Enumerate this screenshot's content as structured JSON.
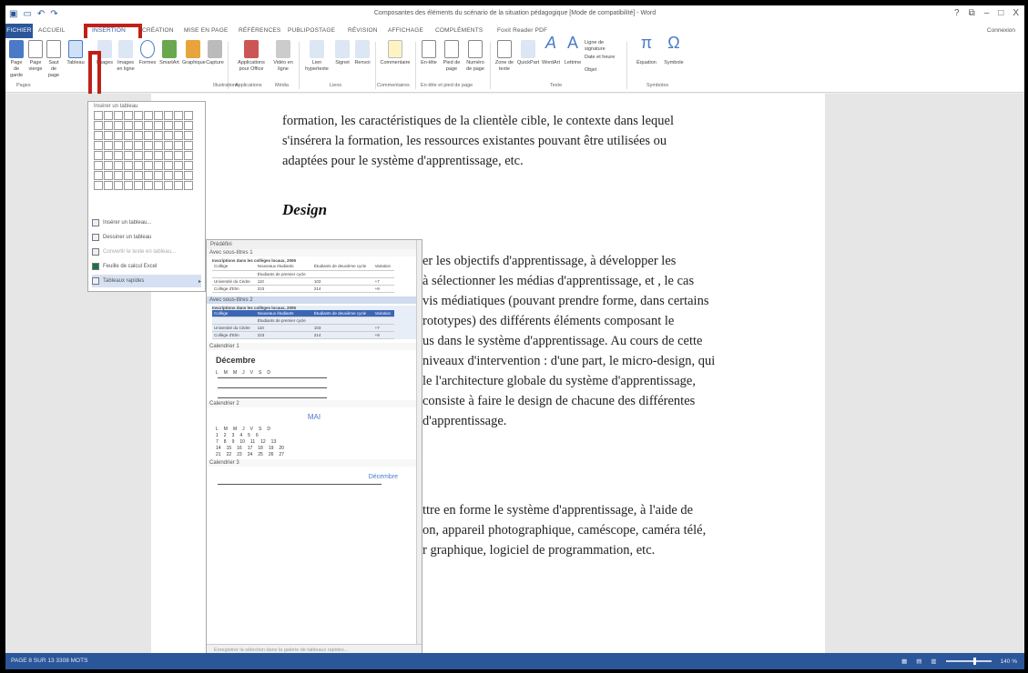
{
  "titlebar": {
    "title": "Composantes des éléments du scénario de la situation pédagogique [Mode de compatibilité] - Word",
    "help": "?",
    "win_restore": "⧉",
    "win_min": "–",
    "win_max": "□",
    "win_close": "X"
  },
  "tabs": [
    "FICHIER",
    "ACCUEIL",
    "INSERTION",
    "CRÉATION",
    "MISE EN PAGE",
    "RÉFÉRENCES",
    "PUBLIPOSTAGE",
    "RÉVISION",
    "AFFICHAGE",
    "COMPLÉMENTS",
    "Foxit Reader PDF"
  ],
  "connexion": "Connexion",
  "ribbon": {
    "buttons": [
      "Page de garde",
      "Page vierge",
      "Saut de page",
      "Tableau",
      "Images",
      "Images en ligne",
      "Formes",
      "SmartArt",
      "Graphique",
      "Capture",
      "Applications pour Office",
      "Vidéo en ligne",
      "Lien hypertexte",
      "Signet",
      "Renvoi",
      "Commentaire",
      "En-tête",
      "Pied de page",
      "Numéro de page",
      "Zone de texte",
      "QuickPart",
      "WordArt",
      "Lettrine",
      "Ligne de signature",
      "Date et heure",
      "Objet",
      "Équation",
      "Symbole"
    ],
    "groups": [
      "Pages",
      "Illustrations",
      "Applications",
      "Média",
      "Liens",
      "Commentaires",
      "En-tête et pied de page",
      "Texte",
      "Symboles"
    ]
  },
  "document": {
    "lines_top": [
      "formation, les caractéristiques de la clientèle cible, le contexte dans lequel",
      "s'insérera la formation, les ressources existantes pouvant être utilisées ou",
      "adaptées pour le système d'apprentissage, etc."
    ],
    "heading": "Design",
    "lines_mid": [
      "er les objectifs d'apprentissage, à développer les",
      "à sélectionner les médias d'apprentissage, et , le cas",
      "vis médiatiques (pouvant prendre forme, dans certains",
      "rototypes) des différents éléments composant le",
      "us dans le système d'apprentissage. Au cours de cette",
      "niveaux d'intervention : d'une part, le micro-design, qui",
      "le l'architecture globale du système d'apprentissage,",
      "consiste à faire le design de chacune des différentes",
      "d'apprentissage."
    ],
    "lines_bottom": [
      "ttre en forme le système d'apprentissage, à l'aide de",
      "on, appareil photographique, caméscope, caméra télé,",
      "r graphique, logiciel de programmation, etc."
    ]
  },
  "table_menu": {
    "header": "Insérer un tableau",
    "items": [
      "Insérer un tableau...",
      "Dessiner un tableau",
      "Convertir le texte en tableau...",
      "Feuille de calcul Excel",
      "Tableaux rapides"
    ]
  },
  "quick_tables": {
    "header": "Prédéfini",
    "sections": [
      "Avec sous-titres 1",
      "Avec sous-titres 2",
      "Calendrier 1",
      "Calendrier 2",
      "Calendrier 3"
    ],
    "table_caption": "Inscriptions dans les collèges locaux, 2005",
    "col_headers": [
      "Collège",
      "Nouveaux étudiants",
      "Étudiants de deuxième cycle",
      "Variation"
    ],
    "sub_row": "Étudiants de premier cycle",
    "rows": [
      [
        "Université du Cèdre",
        "110",
        "103",
        "+7"
      ],
      [
        "Collège d'Elm",
        "223",
        "214",
        "+9"
      ]
    ],
    "cal1_month": "Décembre",
    "cal1_days": [
      "L",
      "M",
      "M",
      "J",
      "V",
      "S",
      "D"
    ],
    "cal2_month": "MAI",
    "cal2_days": [
      "L",
      "M",
      "M",
      "J",
      "V",
      "S",
      "D"
    ],
    "cal2_rows": [
      [
        "",
        "1",
        "2",
        "3",
        "4",
        "5",
        "6"
      ],
      [
        "7",
        "8",
        "9",
        "10",
        "11",
        "12",
        "13"
      ],
      [
        "14",
        "15",
        "16",
        "17",
        "18",
        "19",
        "20"
      ],
      [
        "21",
        "22",
        "23",
        "24",
        "25",
        "26",
        "27"
      ]
    ],
    "cal3_month": "Décembre",
    "footer": "Enregistrer la sélection dans la galerie de tableaux rapides..."
  },
  "statusbar": {
    "left": "PAGE 8 SUR 13    3308 MOTS    ",
    "zoom": "140 %"
  }
}
